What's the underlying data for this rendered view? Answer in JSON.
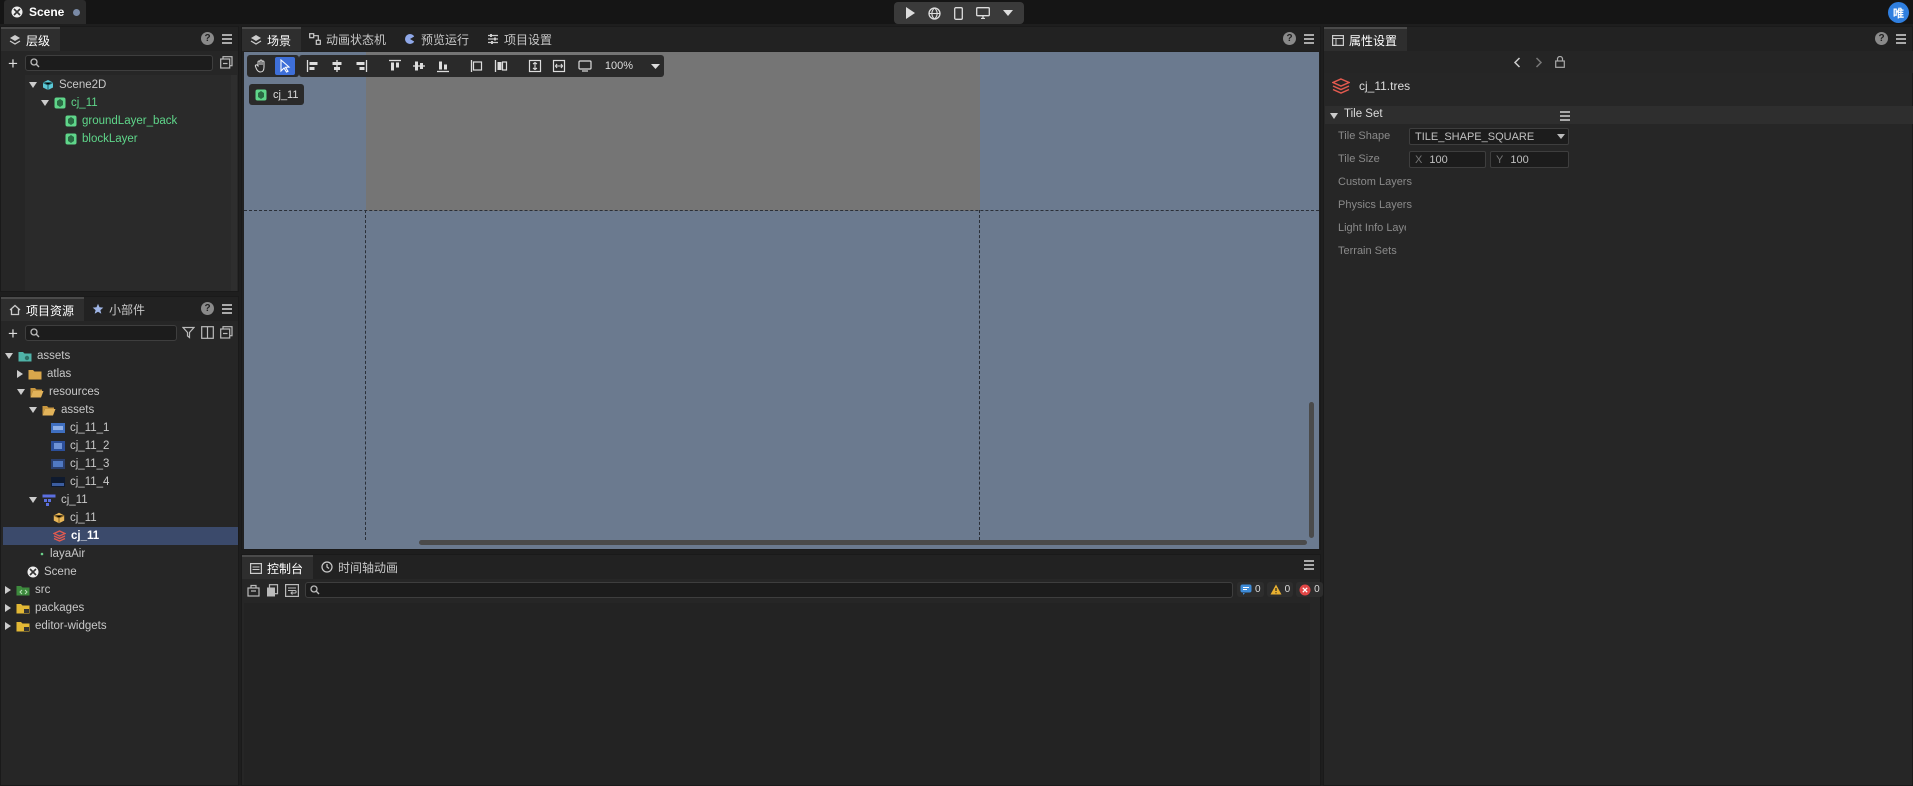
{
  "titlebar": {
    "scene_tab": "Scene",
    "user": "唯"
  },
  "hierarchy": {
    "tab": "层级",
    "help": "?",
    "nodes": [
      {
        "label": "Scene2D"
      },
      {
        "label": "cj_11"
      },
      {
        "label": "groundLayer_back"
      },
      {
        "label": "blockLayer"
      }
    ]
  },
  "scene": {
    "tabs": [
      "场景",
      "动画状态机",
      "预览运行",
      "项目设置"
    ],
    "zoom": "100%",
    "node_chip": "cj_11"
  },
  "assets": {
    "tabs": [
      "项目资源",
      "小部件"
    ],
    "items": [
      {
        "label": "assets"
      },
      {
        "label": "atlas"
      },
      {
        "label": "resources"
      },
      {
        "label": "assets"
      },
      {
        "label": "cj_11_1"
      },
      {
        "label": "cj_11_2"
      },
      {
        "label": "cj_11_3"
      },
      {
        "label": "cj_11_4"
      },
      {
        "label": "cj_11"
      },
      {
        "label": "cj_11"
      },
      {
        "label": "cj_11"
      },
      {
        "label": "layaAir"
      },
      {
        "label": "Scene"
      },
      {
        "label": "src"
      },
      {
        "label": "packages"
      },
      {
        "label": "editor-widgets"
      }
    ]
  },
  "console": {
    "tabs": [
      "控制台",
      "时间轴动画"
    ],
    "info_count": "0",
    "warn_count": "0",
    "error_count": "0"
  },
  "inspector": {
    "tab": "属性设置",
    "file": "cj_11.tres",
    "section": "Tile Set",
    "props": {
      "tile_shape_label": "Tile Shape",
      "tile_shape_value": "TILE_SHAPE_SQUARE",
      "tile_size_label": "Tile Size",
      "x_label": "X",
      "x_value": "100",
      "y_label": "Y",
      "y_value": "100",
      "custom_layers": "Custom Layers",
      "physics_layers": "Physics Layers",
      "light_info": "Light Info Layer",
      "terrain_sets": "Terrain Sets"
    }
  },
  "colors": {
    "accent": "#3e6fd8",
    "selected_row": "#3b4a6b",
    "node_green": "#5fd68a",
    "viewport": "#6b7a8f"
  }
}
